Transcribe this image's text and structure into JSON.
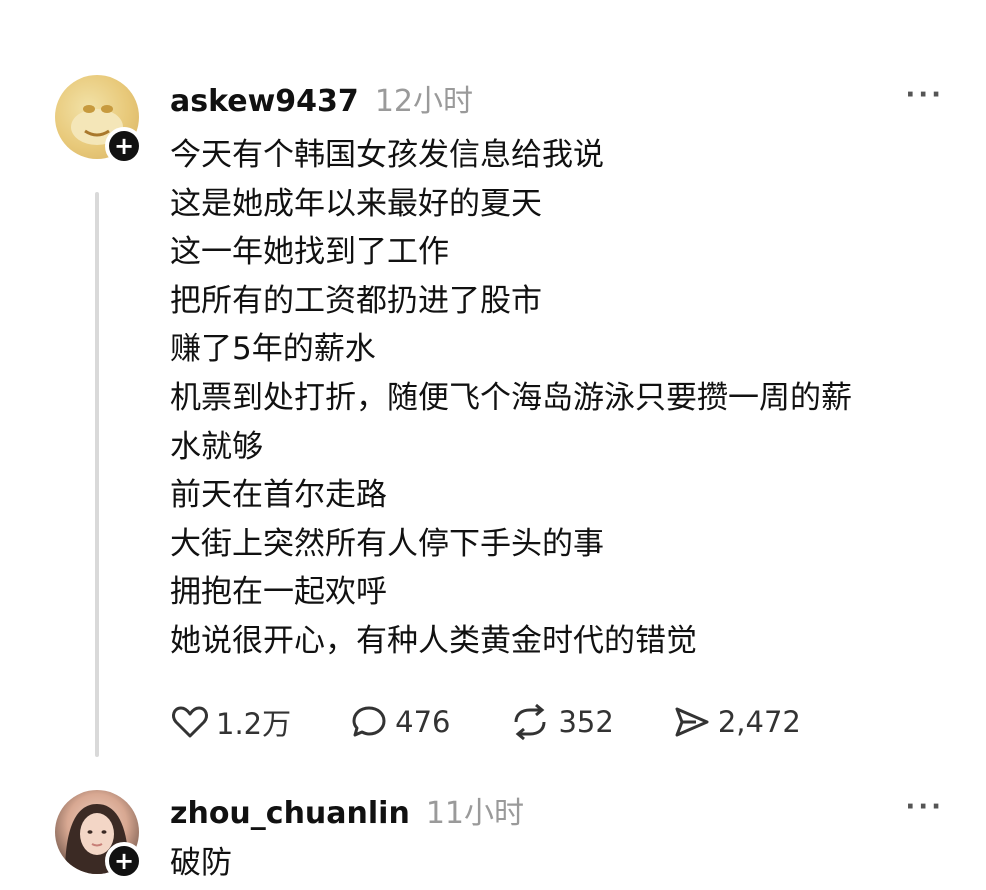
{
  "posts": [
    {
      "username": "askew9437",
      "time": "12小时",
      "more": "···",
      "follow_badge": "+",
      "lines": [
        "今天有个韩国女孩发信息给我说",
        "这是她成年以来最好的夏天",
        "这一年她找到了工作",
        "把所有的工资都扔进了股市",
        "赚了5年的薪水",
        "机票到处打折，随便飞个海岛游泳只要攒一周的薪",
        "水就够",
        "前天在首尔走路",
        "大街上突然所有人停下手头的事",
        "拥抱在一起欢呼",
        "她说很开心，有种人类黄金时代的错觉"
      ],
      "actions": {
        "likes": "1.2万",
        "comments": "476",
        "reposts": "352",
        "shares": "2,472"
      }
    },
    {
      "username": "zhou_chuanlin",
      "time": "11小时",
      "more": "···",
      "follow_badge": "+",
      "lines": [
        "破防"
      ]
    }
  ],
  "icons": {
    "like": "heart-icon",
    "comment": "comment-bubble-icon",
    "repost": "repost-arrows-icon",
    "share": "share-arrow-icon",
    "more": "more-dots-icon",
    "follow": "plus-icon"
  }
}
